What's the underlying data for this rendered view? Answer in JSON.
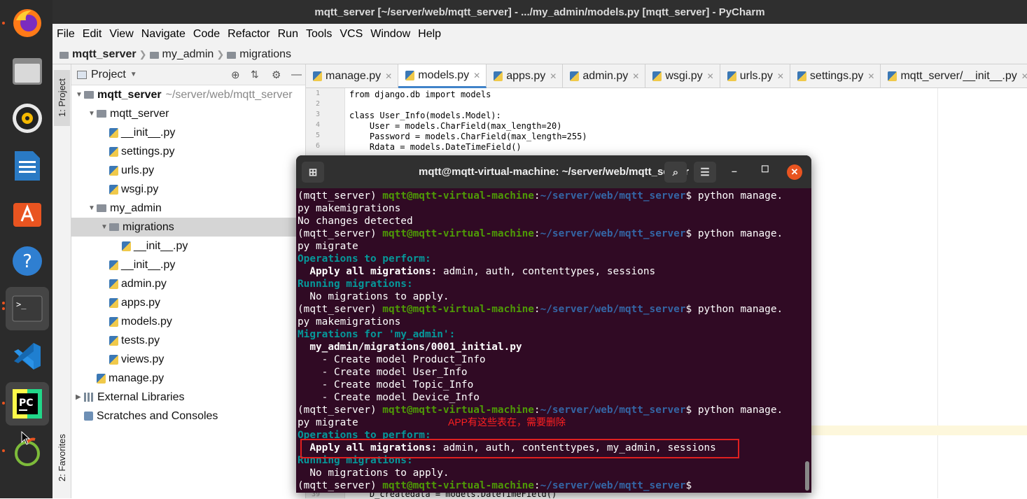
{
  "window_title": "mqtt_server [~/server/web/mqtt_server] - .../my_admin/models.py [mqtt_server] - PyCharm",
  "menu": [
    "File",
    "Edit",
    "View",
    "Navigate",
    "Code",
    "Refactor",
    "Run",
    "Tools",
    "VCS",
    "Window",
    "Help"
  ],
  "breadcrumb": {
    "root": "mqtt_server",
    "p1": "my_admin",
    "p2": "migrations"
  },
  "side_tabs": {
    "project": "1: Project",
    "favorites": "2: Favorites"
  },
  "project_header": "Project",
  "tree": [
    {
      "label": "mqtt_server",
      "suffix": "~/server/web/mqtt_server",
      "depth": 0,
      "kind": "folder",
      "arrow": "▼",
      "bold": true
    },
    {
      "label": "mqtt_server",
      "depth": 1,
      "kind": "folder",
      "arrow": "▼"
    },
    {
      "label": "__init__.py",
      "depth": 2,
      "kind": "py"
    },
    {
      "label": "settings.py",
      "depth": 2,
      "kind": "py"
    },
    {
      "label": "urls.py",
      "depth": 2,
      "kind": "py"
    },
    {
      "label": "wsgi.py",
      "depth": 2,
      "kind": "py"
    },
    {
      "label": "my_admin",
      "depth": 1,
      "kind": "folder",
      "arrow": "▼"
    },
    {
      "label": "migrations",
      "depth": 2,
      "kind": "folder",
      "arrow": "▼",
      "selected": true
    },
    {
      "label": "__init__.py",
      "depth": 3,
      "kind": "py"
    },
    {
      "label": "__init__.py",
      "depth": 2,
      "kind": "py"
    },
    {
      "label": "admin.py",
      "depth": 2,
      "kind": "py"
    },
    {
      "label": "apps.py",
      "depth": 2,
      "kind": "py"
    },
    {
      "label": "models.py",
      "depth": 2,
      "kind": "py"
    },
    {
      "label": "tests.py",
      "depth": 2,
      "kind": "py"
    },
    {
      "label": "views.py",
      "depth": 2,
      "kind": "py"
    },
    {
      "label": "manage.py",
      "depth": 1,
      "kind": "py"
    },
    {
      "label": "External Libraries",
      "depth": 0,
      "kind": "lib",
      "arrow": "▶"
    },
    {
      "label": "Scratches and Consoles",
      "depth": 0,
      "kind": "scratch"
    }
  ],
  "tabs": [
    {
      "label": "manage.py"
    },
    {
      "label": "models.py",
      "active": true
    },
    {
      "label": "apps.py"
    },
    {
      "label": "admin.py"
    },
    {
      "label": "wsgi.py"
    },
    {
      "label": "urls.py"
    },
    {
      "label": "settings.py"
    },
    {
      "label": "mqtt_server/__init__.py"
    }
  ],
  "code": {
    "line_numbers": [
      "1",
      "2",
      "3",
      "4",
      "5",
      "6"
    ],
    "l1": "from django.db import models",
    "l3": "class User_Info(models.Model):",
    "l4": "    User = models.CharField(max_length=20)",
    "l5": "    Password = models.CharField(max_length=255)",
    "l6": "    Rdata = models.DateTimeField()",
    "bottom_line": "    D_createdata = models.DateTimeField()",
    "bottom_line_number": "39"
  },
  "terminal": {
    "title": "mqtt@mqtt-virtual-machine: ~/server/web/mqtt_server",
    "env": "(mqtt_server) ",
    "user": "mqtt@mqtt-virtual-machine",
    "path": "~/server/web/mqtt_server",
    "lines": [
      {
        "t": "prompt",
        "cmd": " python manage."
      },
      {
        "t": "plain",
        "text": "py makemigrations"
      },
      {
        "t": "plain",
        "text": "No changes detected"
      },
      {
        "t": "prompt",
        "cmd": " python manage."
      },
      {
        "t": "plain",
        "text": "py migrate"
      },
      {
        "t": "cyan",
        "text": "Operations to perform:"
      },
      {
        "t": "kv",
        "key": "  Apply all migrations:",
        "val": " admin, auth, contenttypes, sessions"
      },
      {
        "t": "cyan",
        "text": "Running migrations:"
      },
      {
        "t": "plain",
        "text": "  No migrations to apply."
      },
      {
        "t": "prompt",
        "cmd": " python manage."
      },
      {
        "t": "plain",
        "text": "py makemigrations"
      },
      {
        "t": "cyan",
        "text": "Migrations for 'my_admin':"
      },
      {
        "t": "bold",
        "text": "  my_admin/migrations/0001_initial.py"
      },
      {
        "t": "plain",
        "text": "    - Create model Product_Info"
      },
      {
        "t": "plain",
        "text": "    - Create model User_Info"
      },
      {
        "t": "plain",
        "text": "    - Create model Topic_Info"
      },
      {
        "t": "plain",
        "text": "    - Create model Device_Info"
      },
      {
        "t": "prompt",
        "cmd": " python manage."
      },
      {
        "t": "plain",
        "text": "py migrate"
      },
      {
        "t": "cyan",
        "text": "Operations to perform:"
      },
      {
        "t": "kv",
        "key": "  Apply all migrations:",
        "val": " admin, auth, contenttypes, my_admin, sessions"
      },
      {
        "t": "cyan",
        "text": "Running migrations:"
      },
      {
        "t": "plain",
        "text": "  No migrations to apply."
      },
      {
        "t": "prompt",
        "cmd": ""
      }
    ]
  },
  "annotation": "APP有这些表在，需要删除",
  "colors": {
    "term_bg": "#300a24",
    "prompt_green": "#4e9a06",
    "prompt_blue": "#3465a4",
    "cyan": "#06989a",
    "annot_red": "#e02020"
  }
}
